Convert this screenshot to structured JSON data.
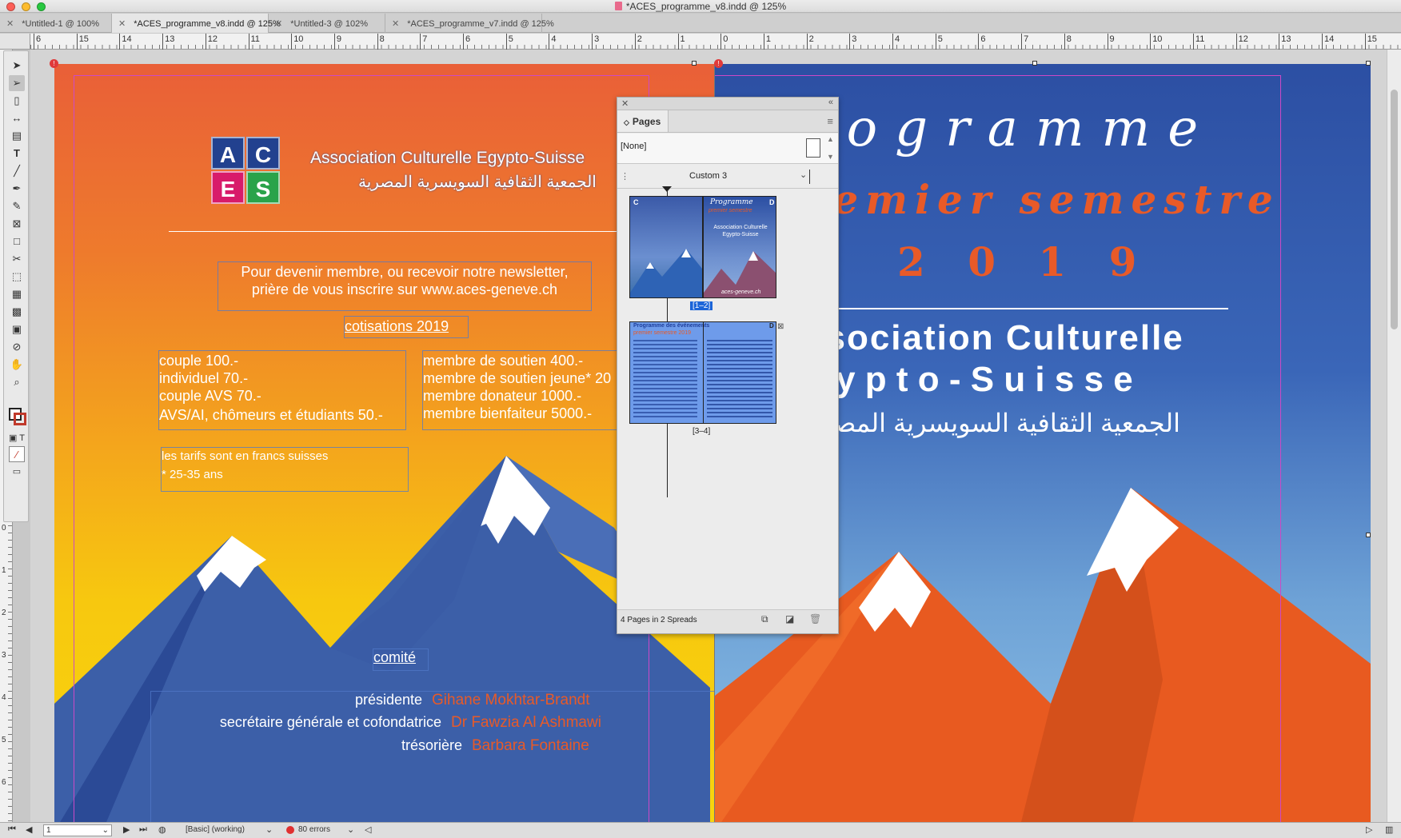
{
  "window": {
    "title": "*ACES_programme_v8.indd @ 125%"
  },
  "tabs": [
    {
      "label": "*Untitled-1 @ 100%"
    },
    {
      "label": "*ACES_programme_v8.indd @ 125%"
    },
    {
      "label": "*Untitled-3 @ 102%"
    },
    {
      "label": "*ACES_programme_v7.indd @ 125%"
    }
  ],
  "ruler": {
    "h": [
      "6",
      "15",
      "14",
      "13",
      "12",
      "11",
      "10",
      "9",
      "8",
      "7",
      "6",
      "5",
      "4",
      "3",
      "2",
      "1",
      "0",
      "1",
      "2",
      "3",
      "4",
      "5",
      "6",
      "7",
      "8",
      "9",
      "10",
      "11",
      "12",
      "13",
      "14",
      "15"
    ],
    "v": [
      "0",
      "1",
      "2",
      "3",
      "4",
      "5",
      "6"
    ]
  },
  "left_page": {
    "logo": {
      "a": "A",
      "c": "C",
      "e": "E",
      "s": "S"
    },
    "org_name_fr": "Association Culturelle Egypto-Suisse",
    "org_name_ar": "الجمعية الثقافية السويسرية المصرية",
    "newsletter_line1": "Pour devenir membre, ou recevoir notre newsletter,",
    "newsletter_line2": "prière de vous inscrire sur www.aces-geneve.ch",
    "cotisations_title": "cotisations 2019",
    "fees_left": [
      "couple 100.-",
      "individuel 70.-",
      "couple AVS 70.-",
      "AVS/AI, chômeurs et étudiants 50.-"
    ],
    "fees_right": [
      "membre de soutien 400.-",
      "membre de soutien jeune* 20",
      "membre donateur 1000.-",
      "membre bienfaiteur 5000.-"
    ],
    "note_line1": "les tarifs sont en francs suisses",
    "note_line2": "* 25-35 ans",
    "comite_title": "comité",
    "committee": [
      {
        "role": "présidente",
        "name": "Gihane Mokhtar-Brandt"
      },
      {
        "role": "secrétaire générale et cofondatrice",
        "name": "Dr Fawzia Al Ashmawi"
      },
      {
        "role": "trésorière",
        "name": "Barbara Fontaine"
      }
    ]
  },
  "right_page": {
    "title_line1": "rogramme",
    "title_line2": "remier semestre",
    "title_line3": "2 0 1 9",
    "assoc_line1": "ssociation Culturelle",
    "assoc_line2": "g y p t o - S u i s s e",
    "assoc_ar": "الجمعية الثقافية السويسرية المصر"
  },
  "pages_panel": {
    "tab_label": "Pages",
    "none_label": "[None]",
    "custom_label": "Custom 3",
    "spread1_label": "[1–2]",
    "spread2_label": "[3–4]",
    "thumb1_title": "Programme",
    "thumb1_sub": "premier semestre",
    "thumb1_org": "Association Culturelle Egypto-Suisse",
    "thumb1_url": "aces-geneve.ch",
    "thumb2_title": "Programme des événements",
    "thumb2_sub": "premier semestre 2019",
    "master_c": "C",
    "master_d": "D",
    "footer_label": "4 Pages in 2 Spreads"
  },
  "statusbar": {
    "page_number": "1",
    "preflight_profile": "[Basic] (working)",
    "errors": "80 errors"
  },
  "colors": {
    "accent_orange": "#e85a28",
    "page_blue": "#2c4fa3",
    "logo_blue": "#22418f",
    "logo_pink": "#d81b6a",
    "logo_green": "#2aa34a",
    "selection": "#1b64d8"
  }
}
